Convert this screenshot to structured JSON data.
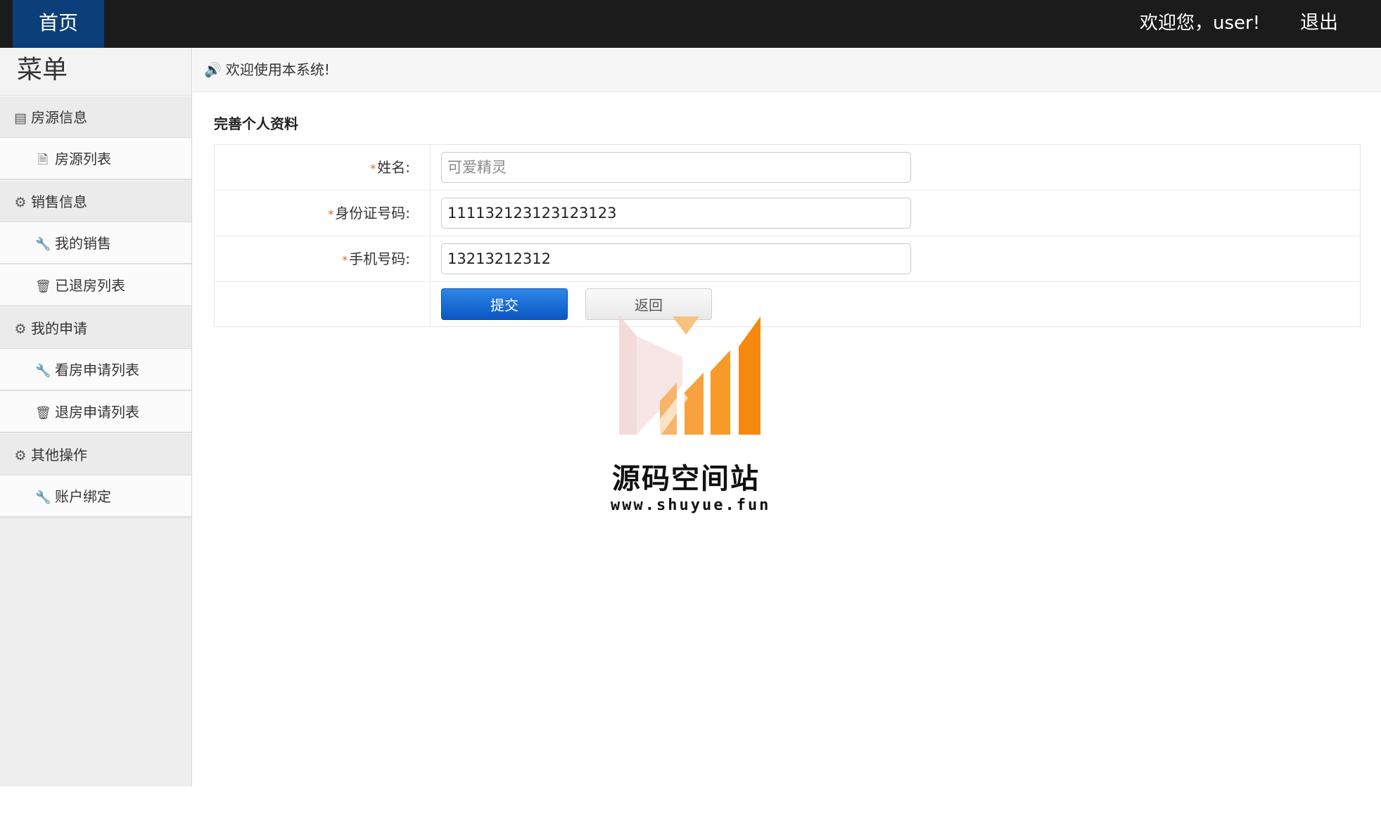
{
  "topbar": {
    "home_label": "首页",
    "welcome_text": "欢迎您，user!",
    "logout_label": "退出"
  },
  "sidebar": {
    "title": "菜单",
    "groups": [
      {
        "label": "房源信息",
        "icon": "contact-card-icon",
        "items": [
          {
            "label": "房源列表",
            "icon": "file-icon"
          }
        ]
      },
      {
        "label": "销售信息",
        "icon": "gear-icon",
        "items": [
          {
            "label": "我的销售",
            "icon": "wrench-icon"
          },
          {
            "label": "已退房列表",
            "icon": "trash-icon"
          }
        ]
      },
      {
        "label": "我的申请",
        "icon": "gear-icon",
        "items": [
          {
            "label": "看房申请列表",
            "icon": "wrench-icon"
          },
          {
            "label": "退房申请列表",
            "icon": "trash-icon"
          }
        ]
      },
      {
        "label": "其他操作",
        "icon": "gear-icon",
        "items": [
          {
            "label": "账户绑定",
            "icon": "wrench-icon"
          }
        ]
      }
    ]
  },
  "notice": {
    "icon": "speaker-icon",
    "text": "欢迎使用本系统!"
  },
  "form": {
    "title": "完善个人资料",
    "required_mark": "*",
    "fields": {
      "name": {
        "label": "姓名:",
        "value": "",
        "placeholder": "可爱精灵"
      },
      "id_card": {
        "label": "身份证号码:",
        "value": "111132123123123123",
        "placeholder": ""
      },
      "phone": {
        "label": "手机号码:",
        "value": "13213212312",
        "placeholder": ""
      }
    },
    "submit_label": "提交",
    "back_label": "返回"
  },
  "watermark": {
    "title": "源码空间站",
    "url": "www.shuyue.fun"
  },
  "colors": {
    "topbar": "#1b1b1b",
    "home_tab": "#0c3e7a",
    "submit_button": "#0a56c4",
    "required_mark": "#d96a2b",
    "watermark_orange": "#f5890f"
  }
}
